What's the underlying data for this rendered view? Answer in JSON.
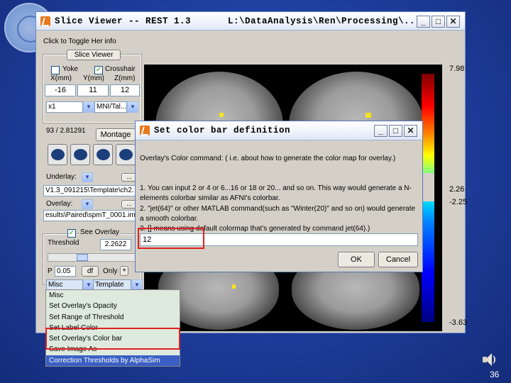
{
  "main_window": {
    "title": "Slice Viewer -- REST 1.3",
    "path": "L:\\DataAnalysis\\Ren\\Processing\\...",
    "controls": {
      "minimize": "_",
      "maximize": "□",
      "close": "✕"
    }
  },
  "left_panel": {
    "toggle_info": "Click to Toggle Her info",
    "slice_viewer_button": "Slice Viewer",
    "yoke_label": "Yoke",
    "crosshair_label": "Crosshair",
    "yoke_checked": false,
    "crosshair_checked": true,
    "coord_headers": [
      "X(mm)",
      "Y(mm)",
      "Z(mm)"
    ],
    "coords": [
      "-16",
      "11",
      "12"
    ],
    "zoom_select": "x1",
    "space_select": "MNI/Tal...",
    "more_button": "...",
    "value_text": "93 / 2.81291",
    "montage_button": "Montage",
    "underlay_label": "Underlay:",
    "underlay_path": "V1.3_091215\\Template\\ch2.",
    "overlay_label": "Overlay:",
    "overlay_path": "esults\\Paired\\spmT_0001.im",
    "see_overlay_label": "See Overlay",
    "see_overlay_checked": true,
    "threshold_label": "Threshold",
    "threshold_value": "2.2622",
    "p_label": "P",
    "p_value": "0.05",
    "df_button": "df",
    "only_label": "Only",
    "plus_button": "+",
    "misc_select": "Misc",
    "template_select": "Template"
  },
  "context_menu": {
    "items": [
      "Misc",
      "Set Overlay's Opacity",
      "Set Range of Threshold",
      "Set Label Color",
      "Set Overlay's Color bar",
      "Save Image As",
      "Correction Thresholds by AlphaSim"
    ],
    "highlighted": "Set Overlay's Color bar"
  },
  "colorbar": {
    "top_value": "7.98",
    "mid_pos": "2.26",
    "mid_neg": "-2.25",
    "bottom_value": "-3.63"
  },
  "dialog": {
    "title": "Set color bar definition",
    "line1": "Overlay's Color command: ( i.e. about how to generate the color map for overlay.)",
    "line2": "1. You can input 2 or 4 or 6...16 or 18 or 20... and so on. This way would generate a N-elements colorbar similar as AFNI's colorbar.",
    "line3": "2. \"jet(64)\" or other MATLAB command(such as \"Winter(20)\" and so on) would generate a smooth colorbar.",
    "line4": "3. [] means using default colormap that's generated by command jet(64).)",
    "input_value": "12",
    "ok_button": "OK",
    "cancel_button": "Cancel"
  },
  "page_number": "36"
}
